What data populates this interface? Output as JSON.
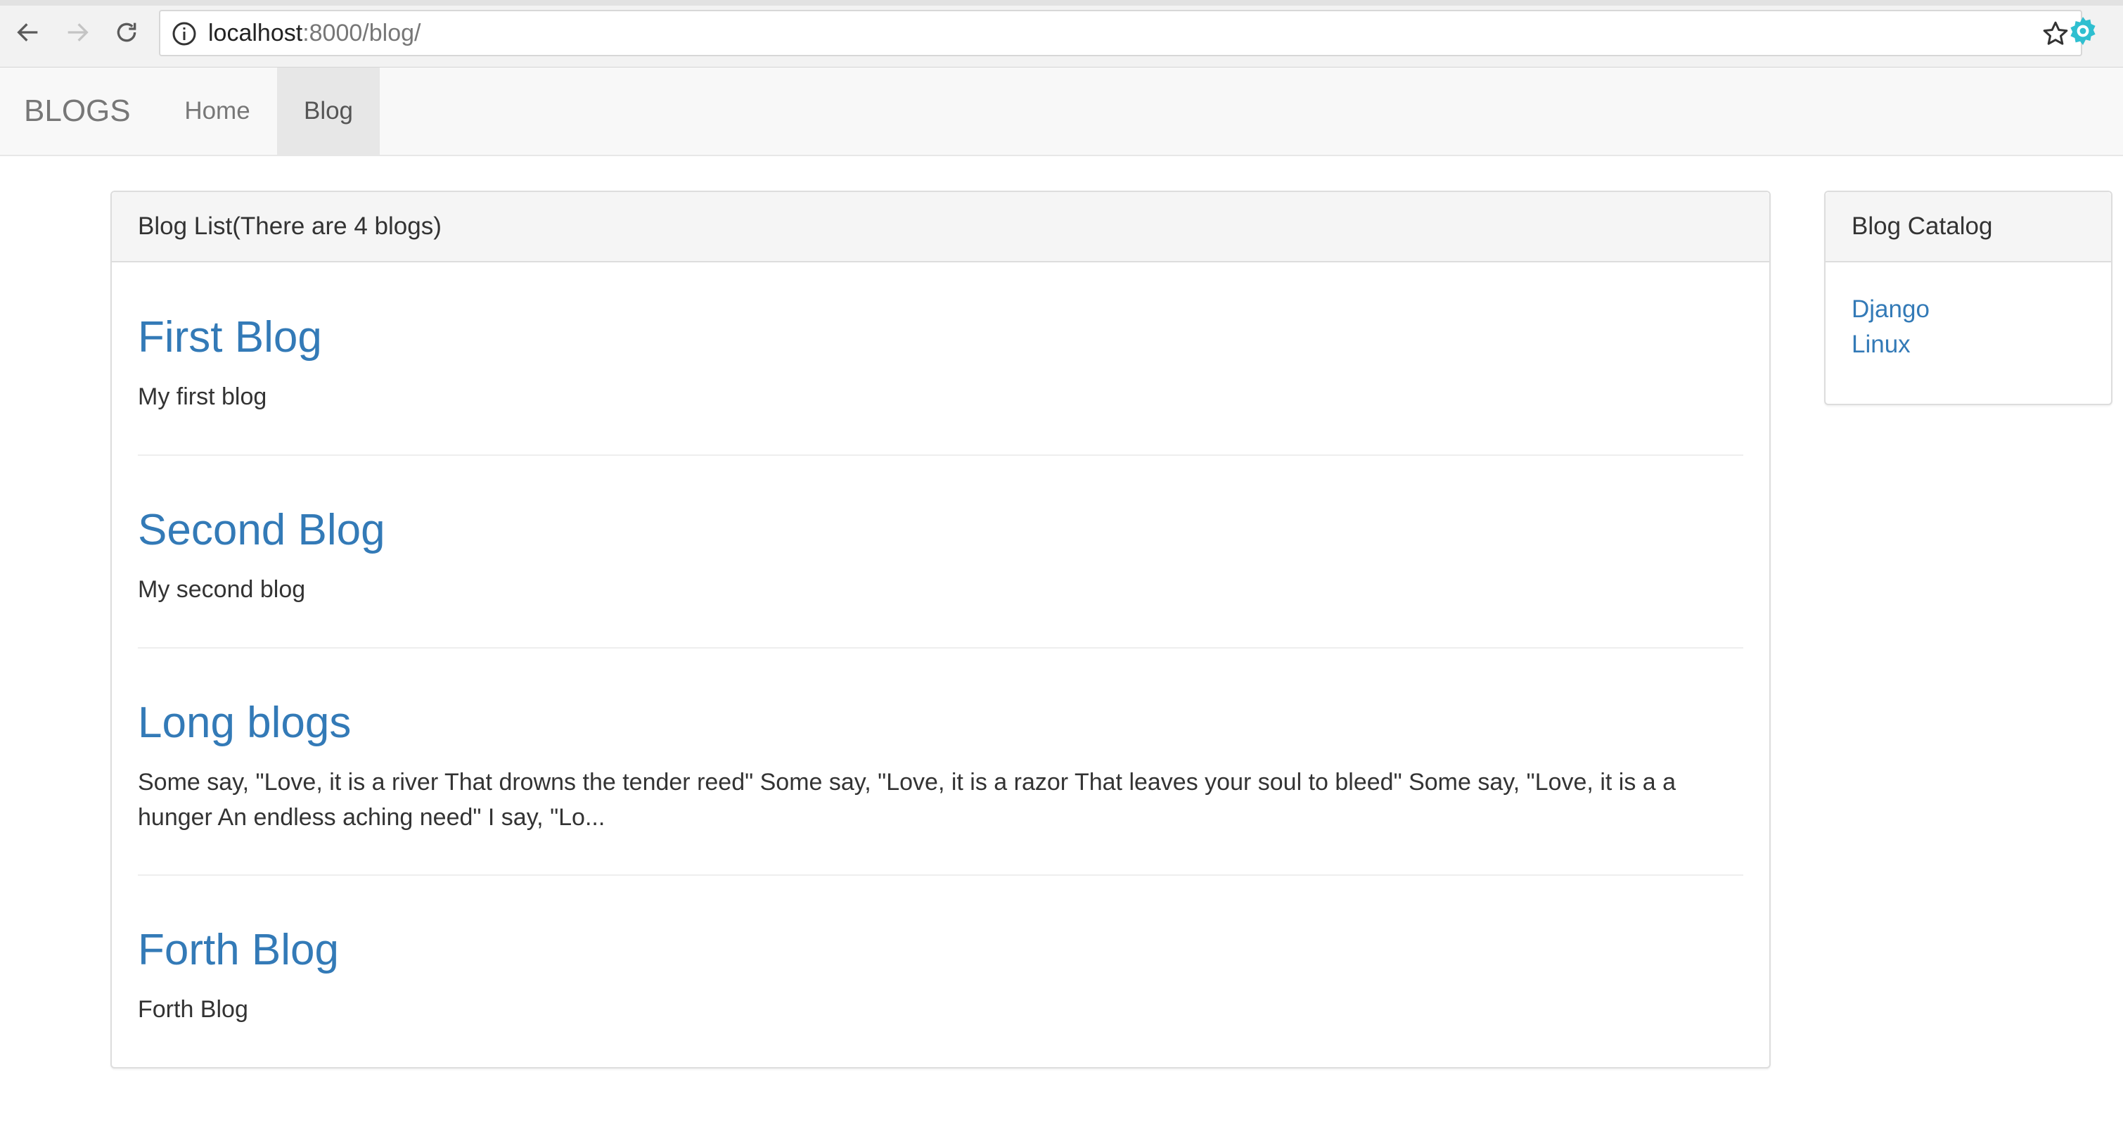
{
  "browser": {
    "url_host": "localhost",
    "url_path": ":8000/blog/",
    "back_icon": "arrow-left-icon",
    "forward_icon": "arrow-right-icon",
    "reload_icon": "reload-icon",
    "info_icon": "info-icon",
    "bookmark_icon": "star-icon",
    "extension_icon": "gear-icon"
  },
  "navbar": {
    "brand": "BLOGS",
    "items": [
      {
        "label": "Home",
        "active": false
      },
      {
        "label": "Blog",
        "active": true
      }
    ]
  },
  "blog_list": {
    "heading": "Blog List(There are 4 blogs)",
    "posts": [
      {
        "title": "First Blog",
        "excerpt": "My first blog"
      },
      {
        "title": "Second Blog",
        "excerpt": "My second blog"
      },
      {
        "title": "Long blogs",
        "excerpt": "Some say, \"Love, it is a river That drowns the tender reed\" Some say, \"Love, it is a razor That leaves your soul to bleed\" Some say, \"Love, it is a a hunger An endless aching need\" I say, \"Lo..."
      },
      {
        "title": "Forth Blog",
        "excerpt": "Forth Blog"
      }
    ]
  },
  "catalog": {
    "heading": "Blog Catalog",
    "items": [
      "Django",
      "Linux"
    ]
  },
  "colors": {
    "link": "#337ab7",
    "navbar_bg": "#f8f8f8",
    "active_nav_bg": "#e7e7e7",
    "panel_heading_bg": "#f5f5f5"
  }
}
